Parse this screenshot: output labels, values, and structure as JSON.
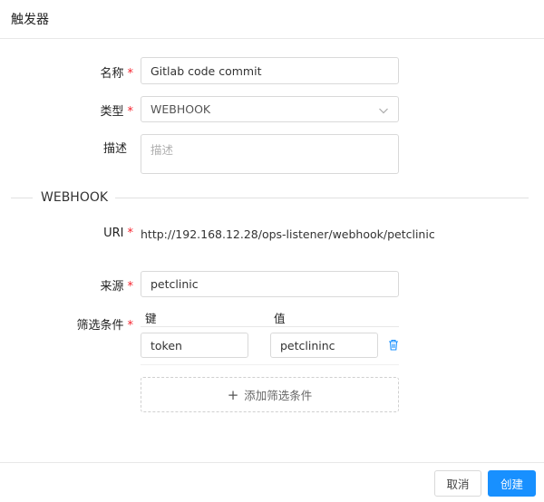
{
  "header": {
    "title": "触发器"
  },
  "form": {
    "name": {
      "label": "名称",
      "required": "*",
      "value": "Gitlab code commit"
    },
    "type": {
      "label": "类型",
      "required": "*",
      "value": "WEBHOOK",
      "icon": "chevron-down-icon"
    },
    "desc": {
      "label": "描述",
      "placeholder": "描述"
    }
  },
  "section": {
    "title": "WEBHOOK"
  },
  "webhook": {
    "uri": {
      "label": "URI",
      "required": "*",
      "value": "http://192.168.12.28/ops-listener/webhook/petclinic"
    },
    "source": {
      "label": "来源",
      "required": "*",
      "value": "petclinic"
    },
    "filters": {
      "label": "筛选条件",
      "required": "*",
      "key_header": "键",
      "value_header": "值",
      "rows": [
        {
          "key": "token",
          "value": "petclininc"
        }
      ],
      "add_label": "添加筛选条件"
    }
  },
  "footer": {
    "cancel_label": "取消",
    "create_label": "创建"
  },
  "colors": {
    "accent": "#1890ff",
    "required": "#f5222d",
    "delete_icon": "#1890ff"
  }
}
